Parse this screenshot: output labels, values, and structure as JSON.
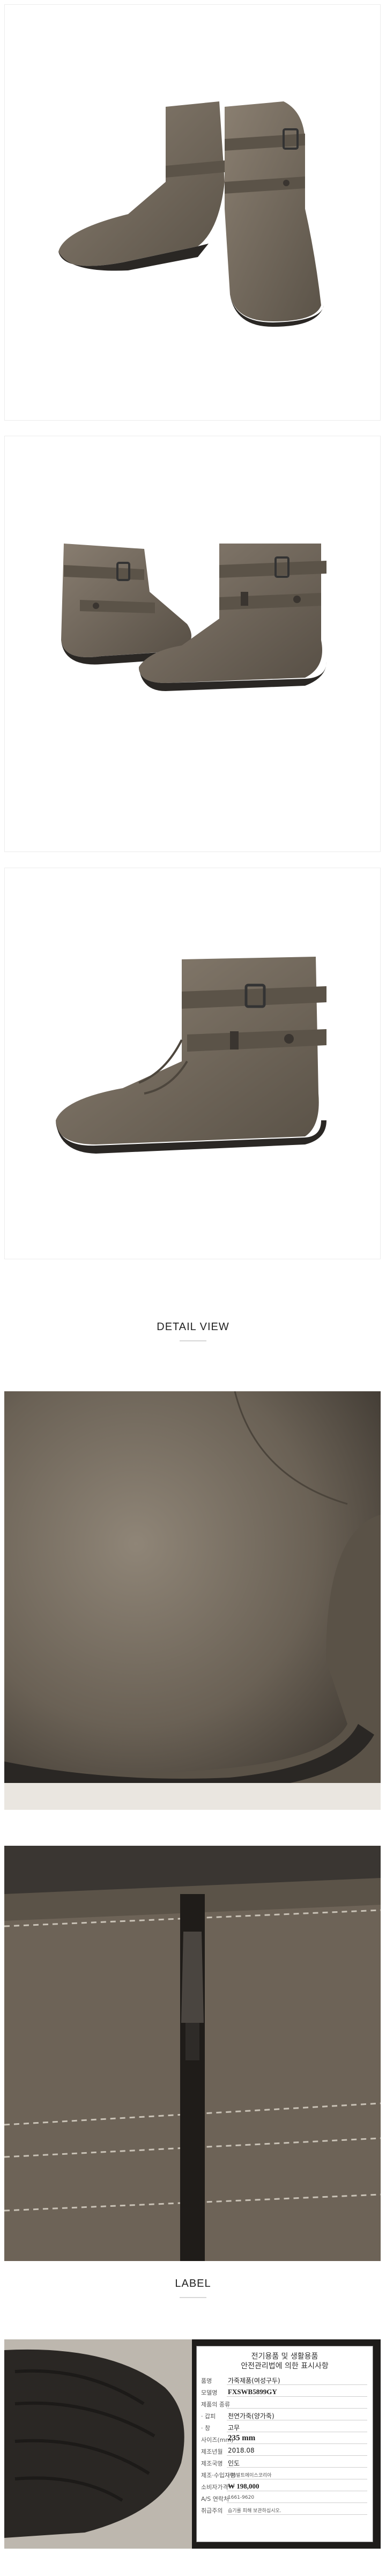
{
  "sections": {
    "detail_title": "DETAIL VIEW",
    "label_title": "LABEL"
  },
  "images": [
    {
      "name": "boot-pair-side-view",
      "icon": "boot-pair-image"
    },
    {
      "name": "boot-pair-front-view",
      "icon": "boot-pair-image"
    },
    {
      "name": "boot-single-side-view",
      "icon": "boot-image"
    },
    {
      "name": "detail-toe-closeup",
      "icon": "leather-closeup-image"
    },
    {
      "name": "detail-zipper-closeup",
      "icon": "zipper-closeup-image"
    },
    {
      "name": "label-sole-photo",
      "icon": "sole-image"
    }
  ],
  "label": {
    "heading_line1": "전기용품 및 생활용품",
    "heading_line2": "안전관리법에 의한 표시사항",
    "rows": [
      {
        "key": "품명",
        "value": "가죽제품(여성구두)",
        "style": "normal"
      },
      {
        "key": "모델명",
        "value": "FXSWB5899GY",
        "style": "serifb"
      },
      {
        "key": "제품의 종류",
        "value": "",
        "style": "normal"
      },
      {
        "key": "· 갑피",
        "value": "천연가죽(양가죽)",
        "style": "normal"
      },
      {
        "key": "· 창",
        "value": "고무",
        "style": "normal"
      },
      {
        "key": "사이즈(mm)",
        "value": "235 mm",
        "style": "big"
      },
      {
        "key": "제조년월",
        "value": "2018.08",
        "style": "normal"
      },
      {
        "key": "제조국명",
        "value": "인도",
        "style": "normal"
      },
      {
        "key": "제조·수입자명",
        "value": "(주)발트에이스코리아",
        "style": "tiny"
      },
      {
        "key": "소비자가격",
        "value": "₩ 198,000",
        "style": "serifb"
      },
      {
        "key": "A/S 연락처",
        "value": "1661-9620",
        "style": "tiny"
      },
      {
        "key": "취급주의",
        "value": "습기를 피해 보관하십시오.",
        "style": "tiny"
      }
    ]
  },
  "colors": {
    "leather": "#6f6558",
    "leather_dark": "#4d463d",
    "sole": "#2a2724",
    "border": "#ececec"
  }
}
